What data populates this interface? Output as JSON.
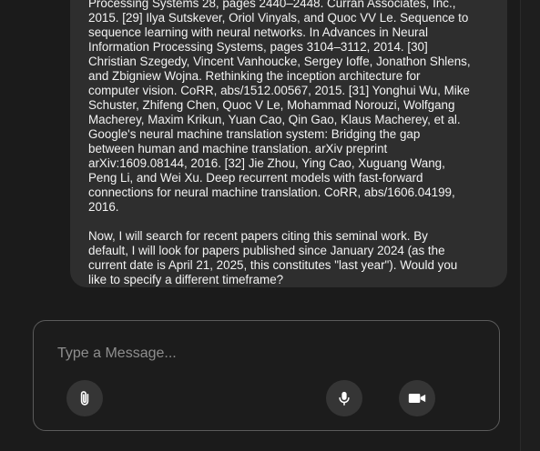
{
  "chat": {
    "assistant_message": {
      "references_text": "Processing Systems 28, pages 2440–2448. Curran Associates, Inc.,\n2015. [29] Ilya Sutskever, Oriol Vinyals, and Quoc VV Le. Sequence to\nsequence learning with neural networks. In Advances in Neural\nInformation Processing Systems, pages 3104–3112, 2014. [30]\nChristian Szegedy, Vincent Vanhoucke, Sergey Ioffe, Jonathon Shlens,\nand Zbigniew Wojna. Rethinking the inception architecture for\ncomputer vision. CoRR, abs/1512.00567, 2015. [31] Yonghui Wu, Mike\nSchuster, Zhifeng Chen, Quoc V Le, Mohammad Norouzi, Wolfgang\nMacherey, Maxim Krikun, Yuan Cao, Qin Gao, Klaus Macherey, et al.\nGoogle's neural machine translation system: Bridging the gap\nbetween human and machine translation. arXiv preprint\narXiv:1609.08144, 2016. [32] Jie Zhou, Ying Cao, Xuguang Wang,\nPeng Li, and Wei Xu. Deep recurrent models with fast-forward\nconnections for neural machine translation. CoRR, abs/1606.04199,\n2016.",
      "question_text": "Now, I will search for recent papers citing this seminal work. By\ndefault, I will look for papers published since January 2024 (as the\ncurrent date is April 21, 2025, this constitutes \"last year\"). Would you\nlike to specify a different timeframe?"
    }
  },
  "composer": {
    "input_value": "",
    "placeholder": "Type a Message...",
    "buttons": {
      "attach": {
        "icon": "paperclip-icon"
      },
      "mic": {
        "icon": "microphone-icon"
      },
      "video": {
        "icon": "video-camera-icon"
      }
    }
  },
  "colors": {
    "background": "#1b1b1b",
    "bubble": "#2e2e2e",
    "composer_border": "#5b5b5b",
    "button_bg": "#353535",
    "text": "#f3f3f3",
    "placeholder": "#8e8e8e"
  }
}
